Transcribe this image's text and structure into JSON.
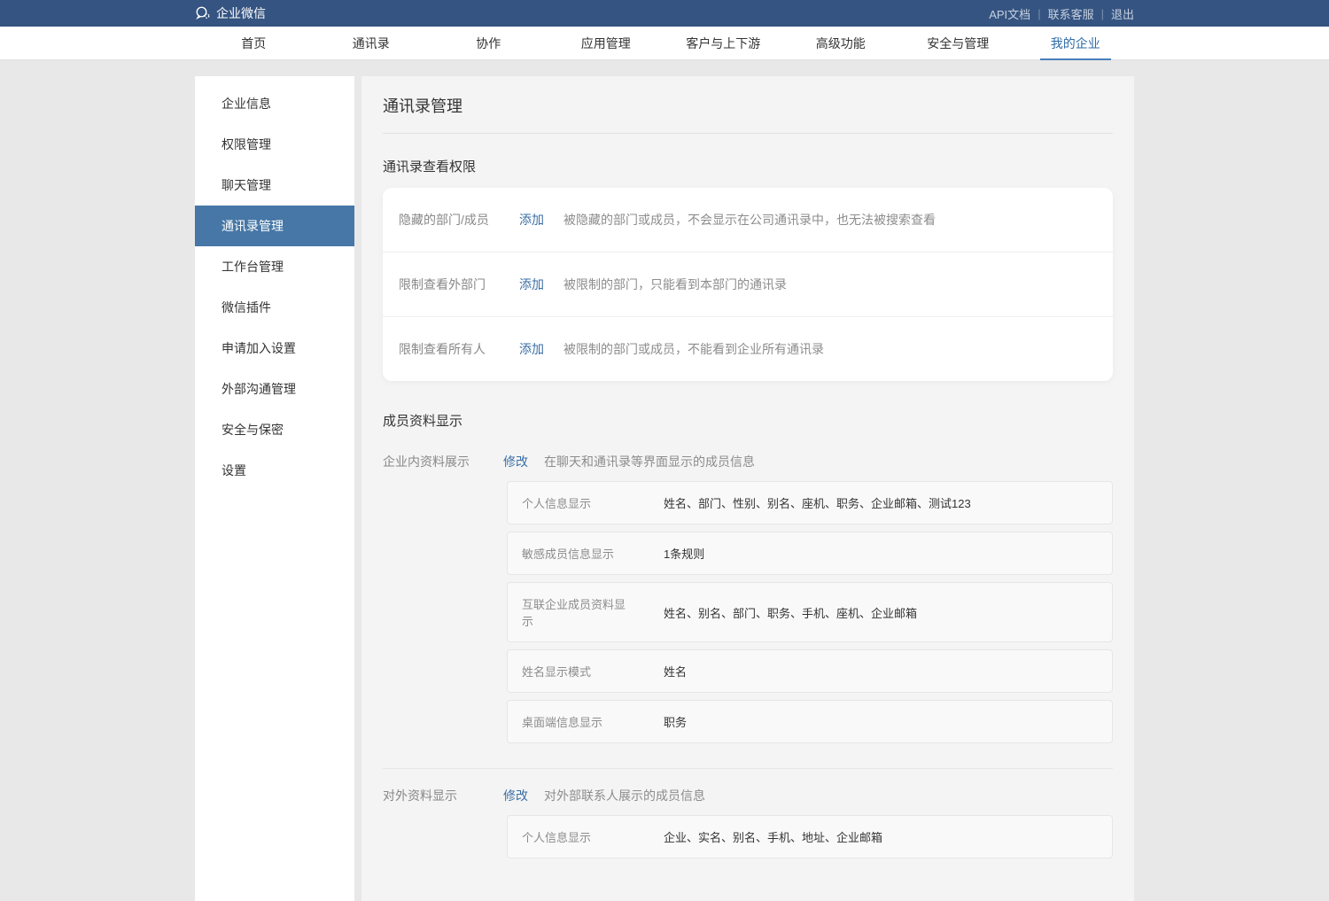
{
  "topbar": {
    "brand": "企业微信",
    "links": {
      "api_doc": "API文档",
      "support": "联系客服",
      "logout": "退出"
    }
  },
  "nav": {
    "items": [
      {
        "label": "首页"
      },
      {
        "label": "通讯录"
      },
      {
        "label": "协作"
      },
      {
        "label": "应用管理"
      },
      {
        "label": "客户与上下游"
      },
      {
        "label": "高级功能"
      },
      {
        "label": "安全与管理"
      },
      {
        "label": "我的企业",
        "active": true
      }
    ]
  },
  "sidebar": {
    "items": [
      {
        "label": "企业信息"
      },
      {
        "label": "权限管理"
      },
      {
        "label": "聊天管理"
      },
      {
        "label": "通讯录管理",
        "active": true
      },
      {
        "label": "工作台管理"
      },
      {
        "label": "微信插件"
      },
      {
        "label": "申请加入设置"
      },
      {
        "label": "外部沟通管理"
      },
      {
        "label": "安全与保密"
      },
      {
        "label": "设置"
      }
    ]
  },
  "page": {
    "title": "通讯录管理",
    "permission_section_title": "通讯录查看权限",
    "permissions": [
      {
        "label": "隐藏的部门/成员",
        "action": "添加",
        "desc": "被隐藏的部门或成员，不会显示在公司通讯录中，也无法被搜索查看"
      },
      {
        "label": "限制查看外部门",
        "action": "添加",
        "desc": "被限制的部门，只能看到本部门的通讯录"
      },
      {
        "label": "限制查看所有人",
        "action": "添加",
        "desc": "被限制的部门或成员，不能看到企业所有通讯录"
      }
    ],
    "member_section_title": "成员资料显示",
    "internal": {
      "label": "企业内资料展示",
      "action": "修改",
      "desc": "在聊天和通讯录等界面显示的成员信息",
      "items": [
        {
          "label": "个人信息显示",
          "value": "姓名、部门、性别、别名、座机、职务、企业邮箱、测试123"
        },
        {
          "label": "敏感成员信息显示",
          "value": "1条规则"
        },
        {
          "label": "互联企业成员资料显示",
          "value": "姓名、别名、部门、职务、手机、座机、企业邮箱"
        },
        {
          "label": "姓名显示模式",
          "value": "姓名"
        },
        {
          "label": "桌面端信息显示",
          "value": "职务"
        }
      ]
    },
    "external": {
      "label": "对外资料显示",
      "action": "修改",
      "desc": "对外部联系人展示的成员信息",
      "items": [
        {
          "label": "个人信息显示",
          "value": "企业、实名、别名、手机、地址、企业邮箱"
        }
      ]
    }
  }
}
